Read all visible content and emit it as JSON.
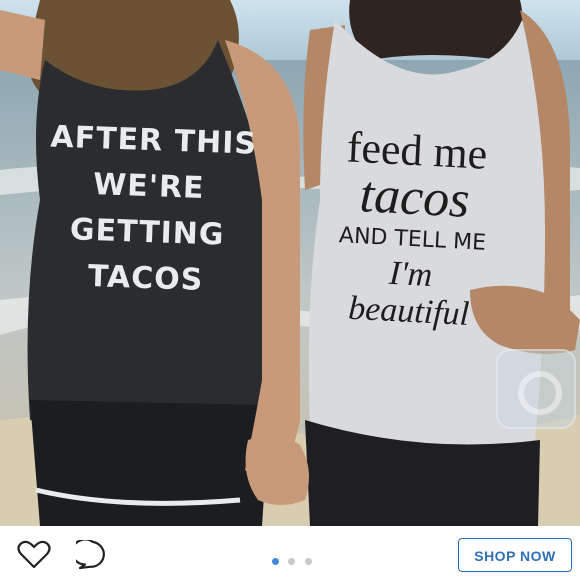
{
  "photo": {
    "left_shirt_lines": [
      "AFTER THIS",
      "WE'RE",
      "GETTING",
      "TACOS"
    ],
    "right_shirt_lines": [
      "feed me",
      "tacos",
      "AND TELL ME",
      "I'm",
      "beautiful"
    ]
  },
  "bar": {
    "like_icon": "heart-icon",
    "comment_icon": "comment-icon",
    "carousel": {
      "total": 3,
      "active": 1
    },
    "shop_button": "SHOP NOW",
    "accent_color": "#2f6fb3"
  }
}
